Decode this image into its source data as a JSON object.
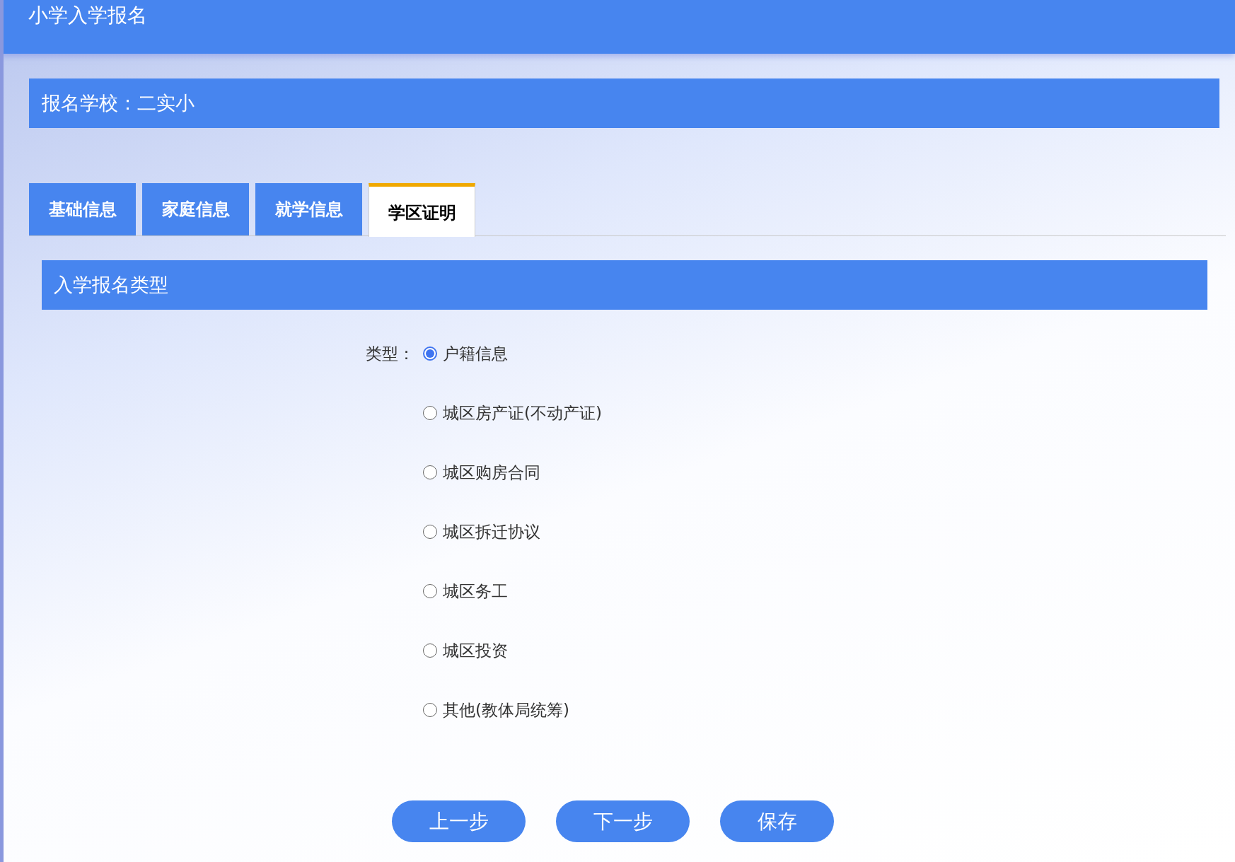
{
  "header": {
    "title": "小学入学报名"
  },
  "school_bar": {
    "text": "报名学校：二实小"
  },
  "tabs": [
    {
      "label": "基础信息",
      "selected": false
    },
    {
      "label": "家庭信息",
      "selected": false
    },
    {
      "label": "就学信息",
      "selected": false
    },
    {
      "label": "学区证明",
      "selected": true
    }
  ],
  "section": {
    "title": "入学报名类型"
  },
  "type_field": {
    "label": "类型：",
    "options": [
      {
        "label": "户籍信息",
        "selected": true
      },
      {
        "label": "城区房产证(不动产证)",
        "selected": false
      },
      {
        "label": "城区购房合同",
        "selected": false
      },
      {
        "label": "城区拆迁协议",
        "selected": false
      },
      {
        "label": "城区务工",
        "selected": false
      },
      {
        "label": "城区投资",
        "selected": false
      },
      {
        "label": "其他(教体局统筹)",
        "selected": false
      }
    ]
  },
  "buttons": [
    "上一步",
    "下一步",
    "保存"
  ]
}
